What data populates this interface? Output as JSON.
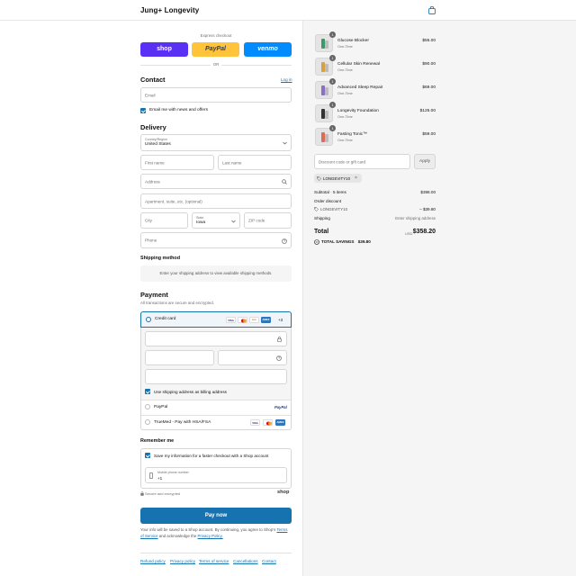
{
  "header": {
    "brand": "Jung+ Longevity",
    "cart_icon": "shopping-bag-icon"
  },
  "express": {
    "label": "Express checkout",
    "shop": "shop",
    "paypal": "PayPal",
    "venmo": "venmo",
    "or": "OR",
    "colors": {
      "shop": "#5a31f4",
      "paypal": "#ffc439",
      "venmo": "#008cff"
    }
  },
  "contact": {
    "title": "Contact",
    "login": "Log in",
    "email_placeholder": "Email",
    "news_label": "Email me with news and offers"
  },
  "delivery": {
    "title": "Delivery",
    "country_label": "Country/Region",
    "country_value": "United States",
    "first_name": "First name",
    "last_name": "Last name",
    "address": "Address",
    "apartment": "Apartment, suite, etc. (optional)",
    "city": "City",
    "state_label": "State",
    "state_value": "Iowa",
    "zip": "ZIP code",
    "phone": "Phone"
  },
  "shipping": {
    "title": "Shipping method",
    "note": "Enter your shipping address to view available shipping methods."
  },
  "payment": {
    "title": "Payment",
    "subtitle": "All transactions are secure and encrypted.",
    "credit_card": "Credit card",
    "cards": [
      "VISA",
      "MC",
      "DISC",
      "AMEX"
    ],
    "more_cards": "+3",
    "billing_label": "Use shipping address as billing address",
    "paypal": "PayPal",
    "paypal_logo": "PayPal",
    "truemed": "TrueMed - Pay with HSA/FSA"
  },
  "remember": {
    "title": "Remember me",
    "save_label": "Save my information for a faster checkout with a Shop account",
    "mobile_label": "Mobile phone number",
    "mobile_value": "+1",
    "secure": "Secure and encrypted",
    "shop_logo": "shop"
  },
  "pay": {
    "button": "Pay now",
    "terms_1": "Your info will be saved to a Shop account. By continuing, you agree to Shop's",
    "terms_link": "Terms of Service",
    "terms_2": "and acknowledge the",
    "privacy_link": "Privacy Policy."
  },
  "footer": [
    "Refund policy",
    "Privacy policy",
    "Terms of service",
    "Cancellations",
    "Contact"
  ],
  "summary": {
    "products": [
      {
        "name": "Glucose Blocker",
        "sub": "One-Time",
        "price": "$55.00",
        "qty": "1",
        "color": "#3a9a6a"
      },
      {
        "name": "Cellular Skin Renewal",
        "sub": "One-Time",
        "price": "$90.00",
        "qty": "1",
        "color": "#d9a13a"
      },
      {
        "name": "Advanced Sleep Repair",
        "sub": "One-Time",
        "price": "$69.00",
        "qty": "1",
        "color": "#8a6fc4"
      },
      {
        "name": "Longevity Foundation",
        "sub": "One-Time",
        "price": "$125.00",
        "qty": "1",
        "color": "#333333"
      },
      {
        "name": "Fasting Tonic™",
        "sub": "One-Time",
        "price": "$59.00",
        "qty": "1",
        "color": "#e06a5a"
      }
    ],
    "discount_placeholder": "Discount code or gift card",
    "apply": "Apply",
    "code_chip": "LONGEVITY10",
    "subtotal_label": "Subtotal · 5 items",
    "subtotal_value": "$398.00",
    "order_discount": "Order discount",
    "discount_code": "LONGEVITY10",
    "discount_value": "– $39.80",
    "shipping_label": "Shipping",
    "shipping_value": "Enter shipping address",
    "total_label": "Total",
    "currency": "USD",
    "total_value": "$358.20",
    "savings_label": "TOTAL SAVINGS",
    "savings_value": "$39.80"
  }
}
